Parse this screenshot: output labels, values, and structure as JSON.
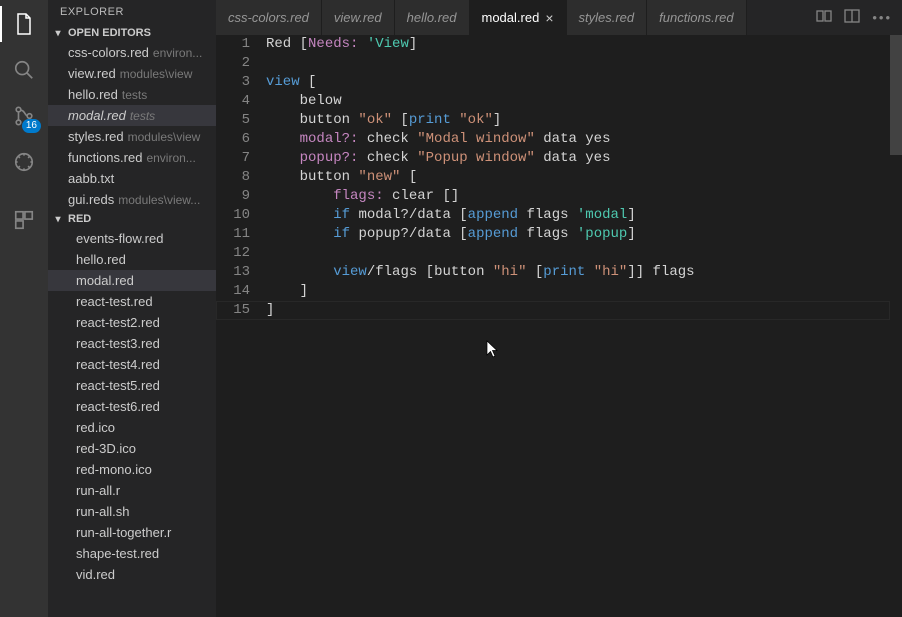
{
  "activity": {
    "scm_badge": "16"
  },
  "sidebar": {
    "title": "EXPLORER",
    "sections": {
      "openEditors": {
        "label": "OPEN EDITORS",
        "items": [
          {
            "name": "css-colors.red",
            "dim": "environ..."
          },
          {
            "name": "view.red",
            "dim": "modules\\view"
          },
          {
            "name": "hello.red",
            "dim": "tests"
          },
          {
            "name": "modal.red",
            "dim": "tests",
            "selected": true,
            "italic": true
          },
          {
            "name": "styles.red",
            "dim": "modules\\view"
          },
          {
            "name": "functions.red",
            "dim": "environ..."
          },
          {
            "name": "aabb.txt",
            "dim": ""
          },
          {
            "name": "gui.reds",
            "dim": "modules\\view..."
          }
        ]
      },
      "workspace": {
        "label": "RED",
        "items": [
          "events-flow.red",
          "hello.red",
          "modal.red",
          "react-test.red",
          "react-test2.red",
          "react-test3.red",
          "react-test4.red",
          "react-test5.red",
          "react-test6.red",
          "red.ico",
          "red-3D.ico",
          "red-mono.ico",
          "run-all.r",
          "run-all.sh",
          "run-all-together.r",
          "shape-test.red",
          "vid.red"
        ],
        "selected": "modal.red"
      }
    }
  },
  "tabs": [
    {
      "label": "css-colors.red"
    },
    {
      "label": "view.red"
    },
    {
      "label": "hello.red"
    },
    {
      "label": "modal.red",
      "active": true,
      "close": true
    },
    {
      "label": "styles.red"
    },
    {
      "label": "functions.red"
    }
  ],
  "code": {
    "line_count": 15,
    "lines": [
      [
        {
          "t": "Red ",
          "c": "tok-w"
        },
        {
          "t": "[",
          "c": "tok-bracket"
        },
        {
          "t": "Needs:",
          "c": "tok-setw"
        },
        {
          "t": " ",
          "c": "tok-w"
        },
        {
          "t": "'View",
          "c": "tok-type"
        },
        {
          "t": "]",
          "c": "tok-bracket"
        }
      ],
      [],
      [
        {
          "t": "view ",
          "c": "tok-view"
        },
        {
          "t": "[",
          "c": "tok-bracket"
        }
      ],
      [
        {
          "t": "    below",
          "c": "tok-w"
        }
      ],
      [
        {
          "t": "    button ",
          "c": "tok-w"
        },
        {
          "t": "\"ok\"",
          "c": "tok-red"
        },
        {
          "t": " [",
          "c": "tok-bracket"
        },
        {
          "t": "print ",
          "c": "tok-view"
        },
        {
          "t": "\"ok\"",
          "c": "tok-red"
        },
        {
          "t": "]",
          "c": "tok-bracket"
        }
      ],
      [
        {
          "t": "    ",
          "c": "tok-w"
        },
        {
          "t": "modal?:",
          "c": "tok-setw"
        },
        {
          "t": " check ",
          "c": "tok-w"
        },
        {
          "t": "\"Modal window\"",
          "c": "tok-red"
        },
        {
          "t": " data yes",
          "c": "tok-w"
        }
      ],
      [
        {
          "t": "    ",
          "c": "tok-w"
        },
        {
          "t": "popup?:",
          "c": "tok-setw"
        },
        {
          "t": " check ",
          "c": "tok-w"
        },
        {
          "t": "\"Popup window\"",
          "c": "tok-red"
        },
        {
          "t": " data yes",
          "c": "tok-w"
        }
      ],
      [
        {
          "t": "    button ",
          "c": "tok-w"
        },
        {
          "t": "\"new\"",
          "c": "tok-red"
        },
        {
          "t": " [",
          "c": "tok-bracket"
        }
      ],
      [
        {
          "t": "        ",
          "c": "tok-w"
        },
        {
          "t": "flags:",
          "c": "tok-setw"
        },
        {
          "t": " clear ",
          "c": "tok-w"
        },
        {
          "t": "[]",
          "c": "tok-bracket"
        }
      ],
      [
        {
          "t": "        ",
          "c": "tok-w"
        },
        {
          "t": "if ",
          "c": "tok-view"
        },
        {
          "t": "modal?/data ",
          "c": "tok-w"
        },
        {
          "t": "[",
          "c": "tok-bracket"
        },
        {
          "t": "append ",
          "c": "tok-view"
        },
        {
          "t": "flags ",
          "c": "tok-w"
        },
        {
          "t": "'modal",
          "c": "tok-type"
        },
        {
          "t": "]",
          "c": "tok-bracket"
        }
      ],
      [
        {
          "t": "        ",
          "c": "tok-w"
        },
        {
          "t": "if ",
          "c": "tok-view"
        },
        {
          "t": "popup?/data ",
          "c": "tok-w"
        },
        {
          "t": "[",
          "c": "tok-bracket"
        },
        {
          "t": "append ",
          "c": "tok-view"
        },
        {
          "t": "flags ",
          "c": "tok-w"
        },
        {
          "t": "'popup",
          "c": "tok-type"
        },
        {
          "t": "]",
          "c": "tok-bracket"
        }
      ],
      [],
      [
        {
          "t": "        ",
          "c": "tok-w"
        },
        {
          "t": "view",
          "c": "tok-view"
        },
        {
          "t": "/",
          "c": "tok-w"
        },
        {
          "t": "flags ",
          "c": "tok-w"
        },
        {
          "t": "[",
          "c": "tok-bracket"
        },
        {
          "t": "button ",
          "c": "tok-w"
        },
        {
          "t": "\"hi\"",
          "c": "tok-red"
        },
        {
          "t": " [",
          "c": "tok-bracket"
        },
        {
          "t": "print ",
          "c": "tok-view"
        },
        {
          "t": "\"hi\"",
          "c": "tok-red"
        },
        {
          "t": "]] ",
          "c": "tok-bracket"
        },
        {
          "t": "flags",
          "c": "tok-w"
        }
      ],
      [
        {
          "t": "    ]",
          "c": "tok-bracket"
        }
      ],
      [
        {
          "t": "]",
          "c": "tok-bracket"
        }
      ]
    ]
  }
}
